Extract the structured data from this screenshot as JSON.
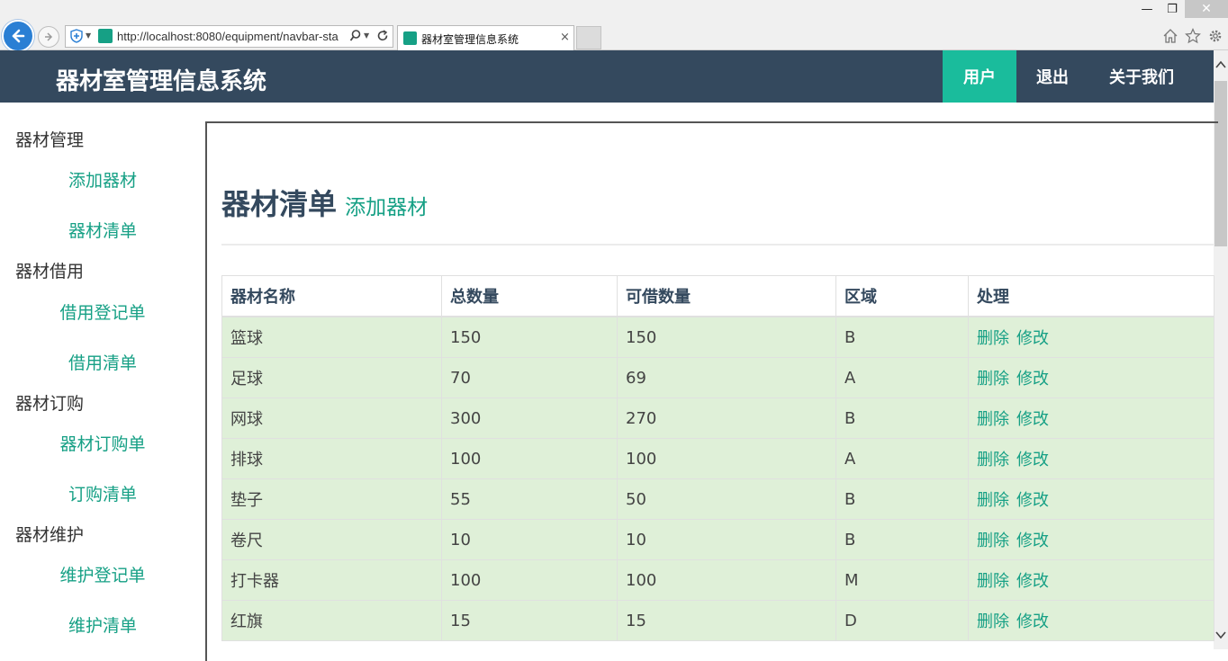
{
  "browser": {
    "url": "http://localhost:8080/equipment/navbar-sta",
    "tab_title": "器材室管理信息系统",
    "tab_close": "×",
    "window_min": "—",
    "window_max": "❐",
    "window_close": "✕"
  },
  "navbar": {
    "brand": "器材室管理信息系统",
    "items": [
      {
        "label": "用户",
        "active": true
      },
      {
        "label": "退出",
        "active": false
      },
      {
        "label": "关于我们",
        "active": false
      }
    ]
  },
  "sidebar": {
    "groups": [
      {
        "heading": "器材管理",
        "links": [
          "添加器材",
          "器材清单"
        ]
      },
      {
        "heading": "器材借用",
        "links": [
          "借用登记单",
          "借用清单"
        ]
      },
      {
        "heading": "器材订购",
        "links": [
          "器材订购单",
          "订购清单"
        ]
      },
      {
        "heading": "器材维护",
        "links": [
          "维护登记单",
          "维护清单"
        ]
      }
    ]
  },
  "main": {
    "title": "器材清单",
    "title_link": "添加器材",
    "table": {
      "headers": [
        "器材名称",
        "总数量",
        "可借数量",
        "区域",
        "处理"
      ],
      "rows": [
        [
          "篮球",
          "150",
          "150",
          "B"
        ],
        [
          "足球",
          "70",
          "69",
          "A"
        ],
        [
          "网球",
          "300",
          "270",
          "B"
        ],
        [
          "排球",
          "100",
          "100",
          "A"
        ],
        [
          "垫子",
          "55",
          "50",
          "B"
        ],
        [
          "卷尺",
          "10",
          "10",
          "B"
        ],
        [
          "打卡器",
          "100",
          "100",
          "M"
        ],
        [
          "红旗",
          "15",
          "15",
          "D"
        ]
      ],
      "actions": {
        "delete": "删除",
        "edit": "修改"
      }
    }
  },
  "colors": {
    "navbar": "#34495e",
    "accent": "#1abc9c",
    "link": "#16a085",
    "row_bg": "#dff0d8"
  }
}
